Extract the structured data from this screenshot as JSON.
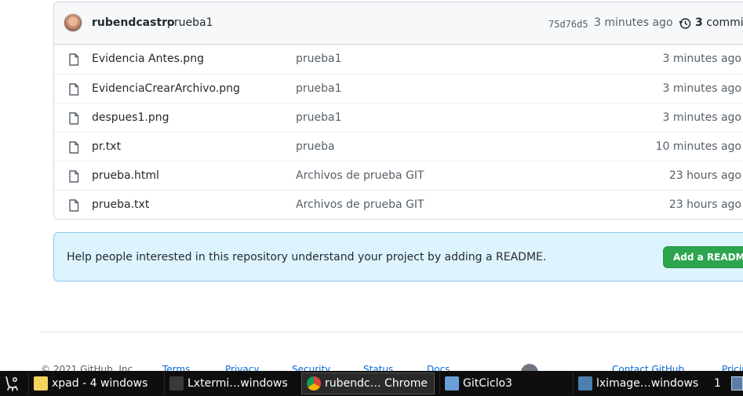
{
  "commit": {
    "author": "rubendcastro",
    "message": "prueba1",
    "sha": "75d76d5",
    "time": "3 minutes ago",
    "count": "3",
    "count_label": "commits"
  },
  "files": [
    {
      "name": "Evidencia Antes.png",
      "message": "prueba1",
      "time": "3 minutes ago"
    },
    {
      "name": "EvidenciaCrearArchivo.png",
      "message": "prueba1",
      "time": "3 minutes ago"
    },
    {
      "name": "despues1.png",
      "message": "prueba1",
      "time": "3 minutes ago"
    },
    {
      "name": "pr.txt",
      "message": "prueba",
      "time": "10 minutes ago"
    },
    {
      "name": "prueba.html",
      "message": "Archivos de prueba GIT",
      "time": "23 hours ago"
    },
    {
      "name": "prueba.txt",
      "message": "Archivos de prueba GIT",
      "time": "23 hours ago"
    }
  ],
  "readme": {
    "text": "Help people interested in this repository understand your project by adding a README.",
    "button": "Add a README"
  },
  "footer": {
    "copyright": "© 2021 GitHub, Inc.",
    "links": [
      "Terms",
      "Privacy",
      "Security",
      "Status",
      "Docs",
      "Contact GitHub",
      "Pricing"
    ]
  },
  "taskbar": {
    "items": [
      {
        "label": "xpad - 4 windows",
        "icon": "sticky-note-icon",
        "color": "#f4d35e"
      },
      {
        "label": "Lxtermi…windows",
        "icon": "terminal-icon",
        "color": "#3a3a3a"
      },
      {
        "label": "rubendc… Chrome",
        "icon": "chrome-icon",
        "color": "#db4437"
      },
      {
        "label": "GitCiclo3",
        "icon": "folder-icon",
        "color": "#6a9fd8"
      },
      {
        "label": "lximage…windows",
        "icon": "image-viewer-icon",
        "color": "#4a7fb0"
      }
    ],
    "desktop_number": "1"
  },
  "colors": {
    "accent_button": "#2da44e",
    "banner_bg": "#ddf4ff",
    "link": "#0969da"
  }
}
